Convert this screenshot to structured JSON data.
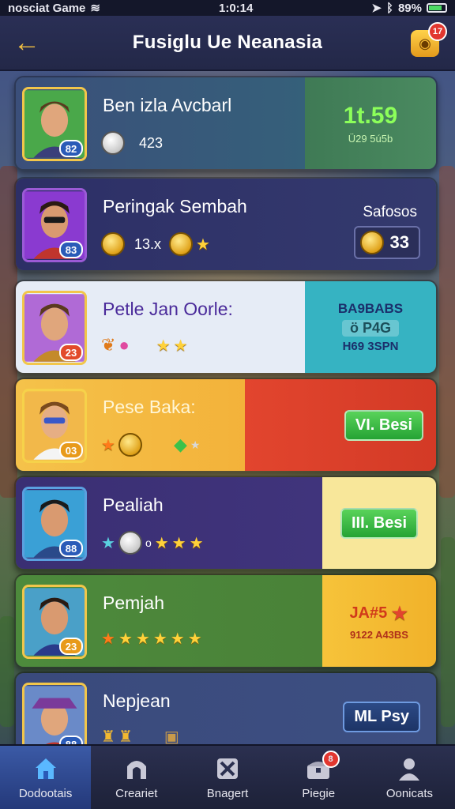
{
  "status_bar": {
    "left_text": "nosciat Game",
    "time": "1:0:14",
    "battery": "89%"
  },
  "header": {
    "title": "Fusiglu Ue Neanasia",
    "gift_badge": "17"
  },
  "players": [
    {
      "name": "Ben izla Avcbarl",
      "level": "82",
      "stat_text": "423",
      "right_main": "1t.59",
      "right_sub": "Ü29 5ú5b",
      "left_color": "#3b4f7a",
      "right_color": "#3f7a55"
    },
    {
      "name": "Peringak Sembah",
      "level": "83",
      "stat_text": "13.x",
      "right_label": "Safosos",
      "right_value": "33",
      "left_color": "#2d2f66",
      "right_color": "#2d2f66"
    },
    {
      "name": "Petle Jan Oorle:",
      "level": "23",
      "right_line1": "BA9BABS",
      "right_line2": "ö P4G",
      "right_line3": "H69 3SPN",
      "left_color": "#e6ecf6",
      "right_color": "#36b3c2"
    },
    {
      "name": "Pese Baka:",
      "level": "03",
      "right_button": "VI. Besi",
      "left_color": "#f5c24a",
      "right_color": "#e2452e"
    },
    {
      "name": "Pealiah",
      "level": "88",
      "stat_text": "o",
      "right_button": "III. Besi",
      "left_color": "#3a2f73",
      "right_color": "#f8e79a"
    },
    {
      "name": "Pemjah",
      "level": "23",
      "right_line1": "JA#5",
      "right_line2": "9122 A43BS",
      "left_color": "#4d8a3c",
      "right_color": "#f6c33a"
    },
    {
      "name": "Nepjean",
      "level": "88",
      "right_button": "ML Psy",
      "left_color": "#3a4a7c",
      "right_color": "#3a4a7c"
    }
  ],
  "bottom_nav": [
    {
      "label": "Dodootais",
      "icon": "home-icon",
      "active": true
    },
    {
      "label": "Creariet",
      "icon": "arch-icon"
    },
    {
      "label": "Bnagert",
      "icon": "tools-icon"
    },
    {
      "label": "Piegie",
      "icon": "chest-icon",
      "badge": "8"
    },
    {
      "label": "Oonicats",
      "icon": "person-icon"
    }
  ]
}
